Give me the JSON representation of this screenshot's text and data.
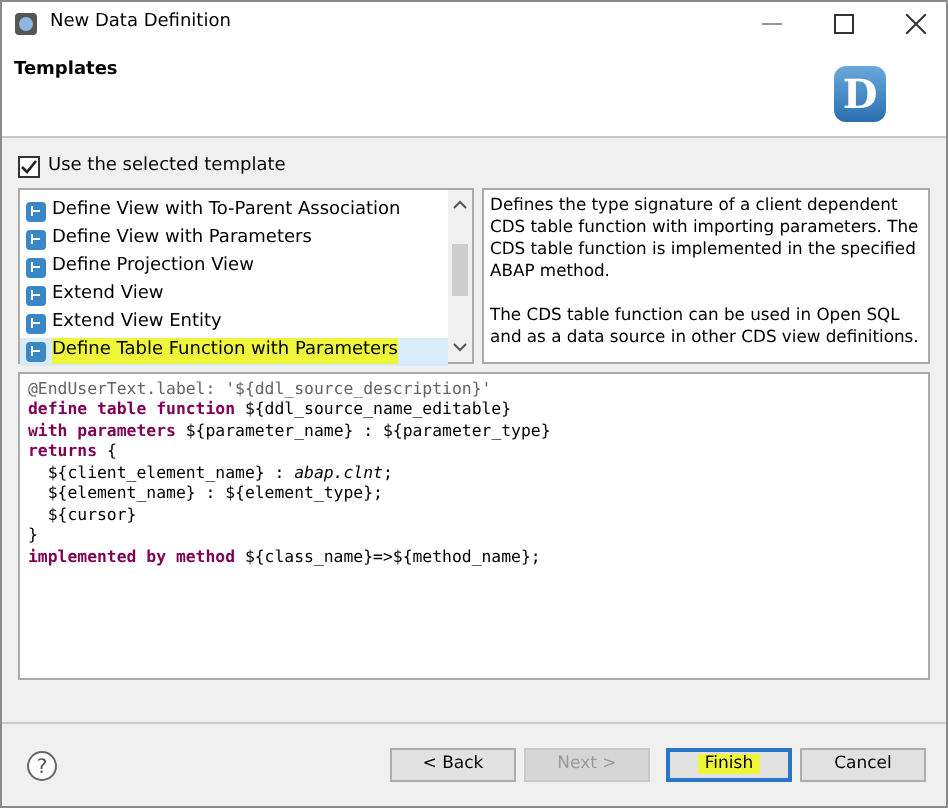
{
  "window": {
    "title": "New Data Definition"
  },
  "header": {
    "title": "Templates",
    "logo_letter": "D"
  },
  "use_template": {
    "label": "Use the selected template",
    "checked": true
  },
  "templates": [
    {
      "label": "Define View with To-Parent Association",
      "selected": false,
      "highlighted": false
    },
    {
      "label": "Define View with Parameters",
      "selected": false,
      "highlighted": false
    },
    {
      "label": "Define Projection View",
      "selected": false,
      "highlighted": false
    },
    {
      "label": "Extend View",
      "selected": false,
      "highlighted": false
    },
    {
      "label": "Extend View Entity",
      "selected": false,
      "highlighted": false
    },
    {
      "label": "Define Table Function with Parameters",
      "selected": true,
      "highlighted": true
    }
  ],
  "description": [
    "Defines the type signature of a client dependent CDS table function with importing parameters. The CDS table function is implemented in the specified ABAP method.",
    "The CDS table function can be used in Open SQL and as a data source in other CDS view definitions."
  ],
  "code": [
    [
      {
        "kind": "annotation",
        "text": "@EndUserText.label: '${ddl_source_description}'"
      }
    ],
    [
      {
        "kind": "keyword",
        "text": "define table function"
      },
      {
        "kind": "text",
        "text": " ${ddl_source_name_editable}"
      }
    ],
    [
      {
        "kind": "keyword",
        "text": "with parameters"
      },
      {
        "kind": "text",
        "text": " ${parameter_name} : ${parameter_type}"
      }
    ],
    [
      {
        "kind": "keyword",
        "text": "returns"
      },
      {
        "kind": "text",
        "text": " {"
      }
    ],
    [
      {
        "kind": "text",
        "text": "  ${client_element_name} : "
      },
      {
        "kind": "italic",
        "text": "abap.clnt"
      },
      {
        "kind": "text",
        "text": ";"
      }
    ],
    [
      {
        "kind": "text",
        "text": "  ${element_name} : ${element_type};"
      }
    ],
    [
      {
        "kind": "text",
        "text": "  ${cursor}"
      }
    ],
    [
      {
        "kind": "text",
        "text": "}"
      }
    ],
    [
      {
        "kind": "keyword",
        "text": "implemented by method"
      },
      {
        "kind": "text",
        "text": " ${class_name}=>${method_name};"
      }
    ]
  ],
  "help_icon": "?",
  "buttons": [
    {
      "label": "< Back",
      "disabled": false,
      "default": false,
      "highlighted": false
    },
    {
      "label": "Next >",
      "disabled": true,
      "default": false,
      "highlighted": false
    },
    {
      "label": "Finish",
      "disabled": false,
      "default": true,
      "highlighted": true
    },
    {
      "label": "Cancel",
      "disabled": false,
      "default": false,
      "highlighted": false
    }
  ]
}
